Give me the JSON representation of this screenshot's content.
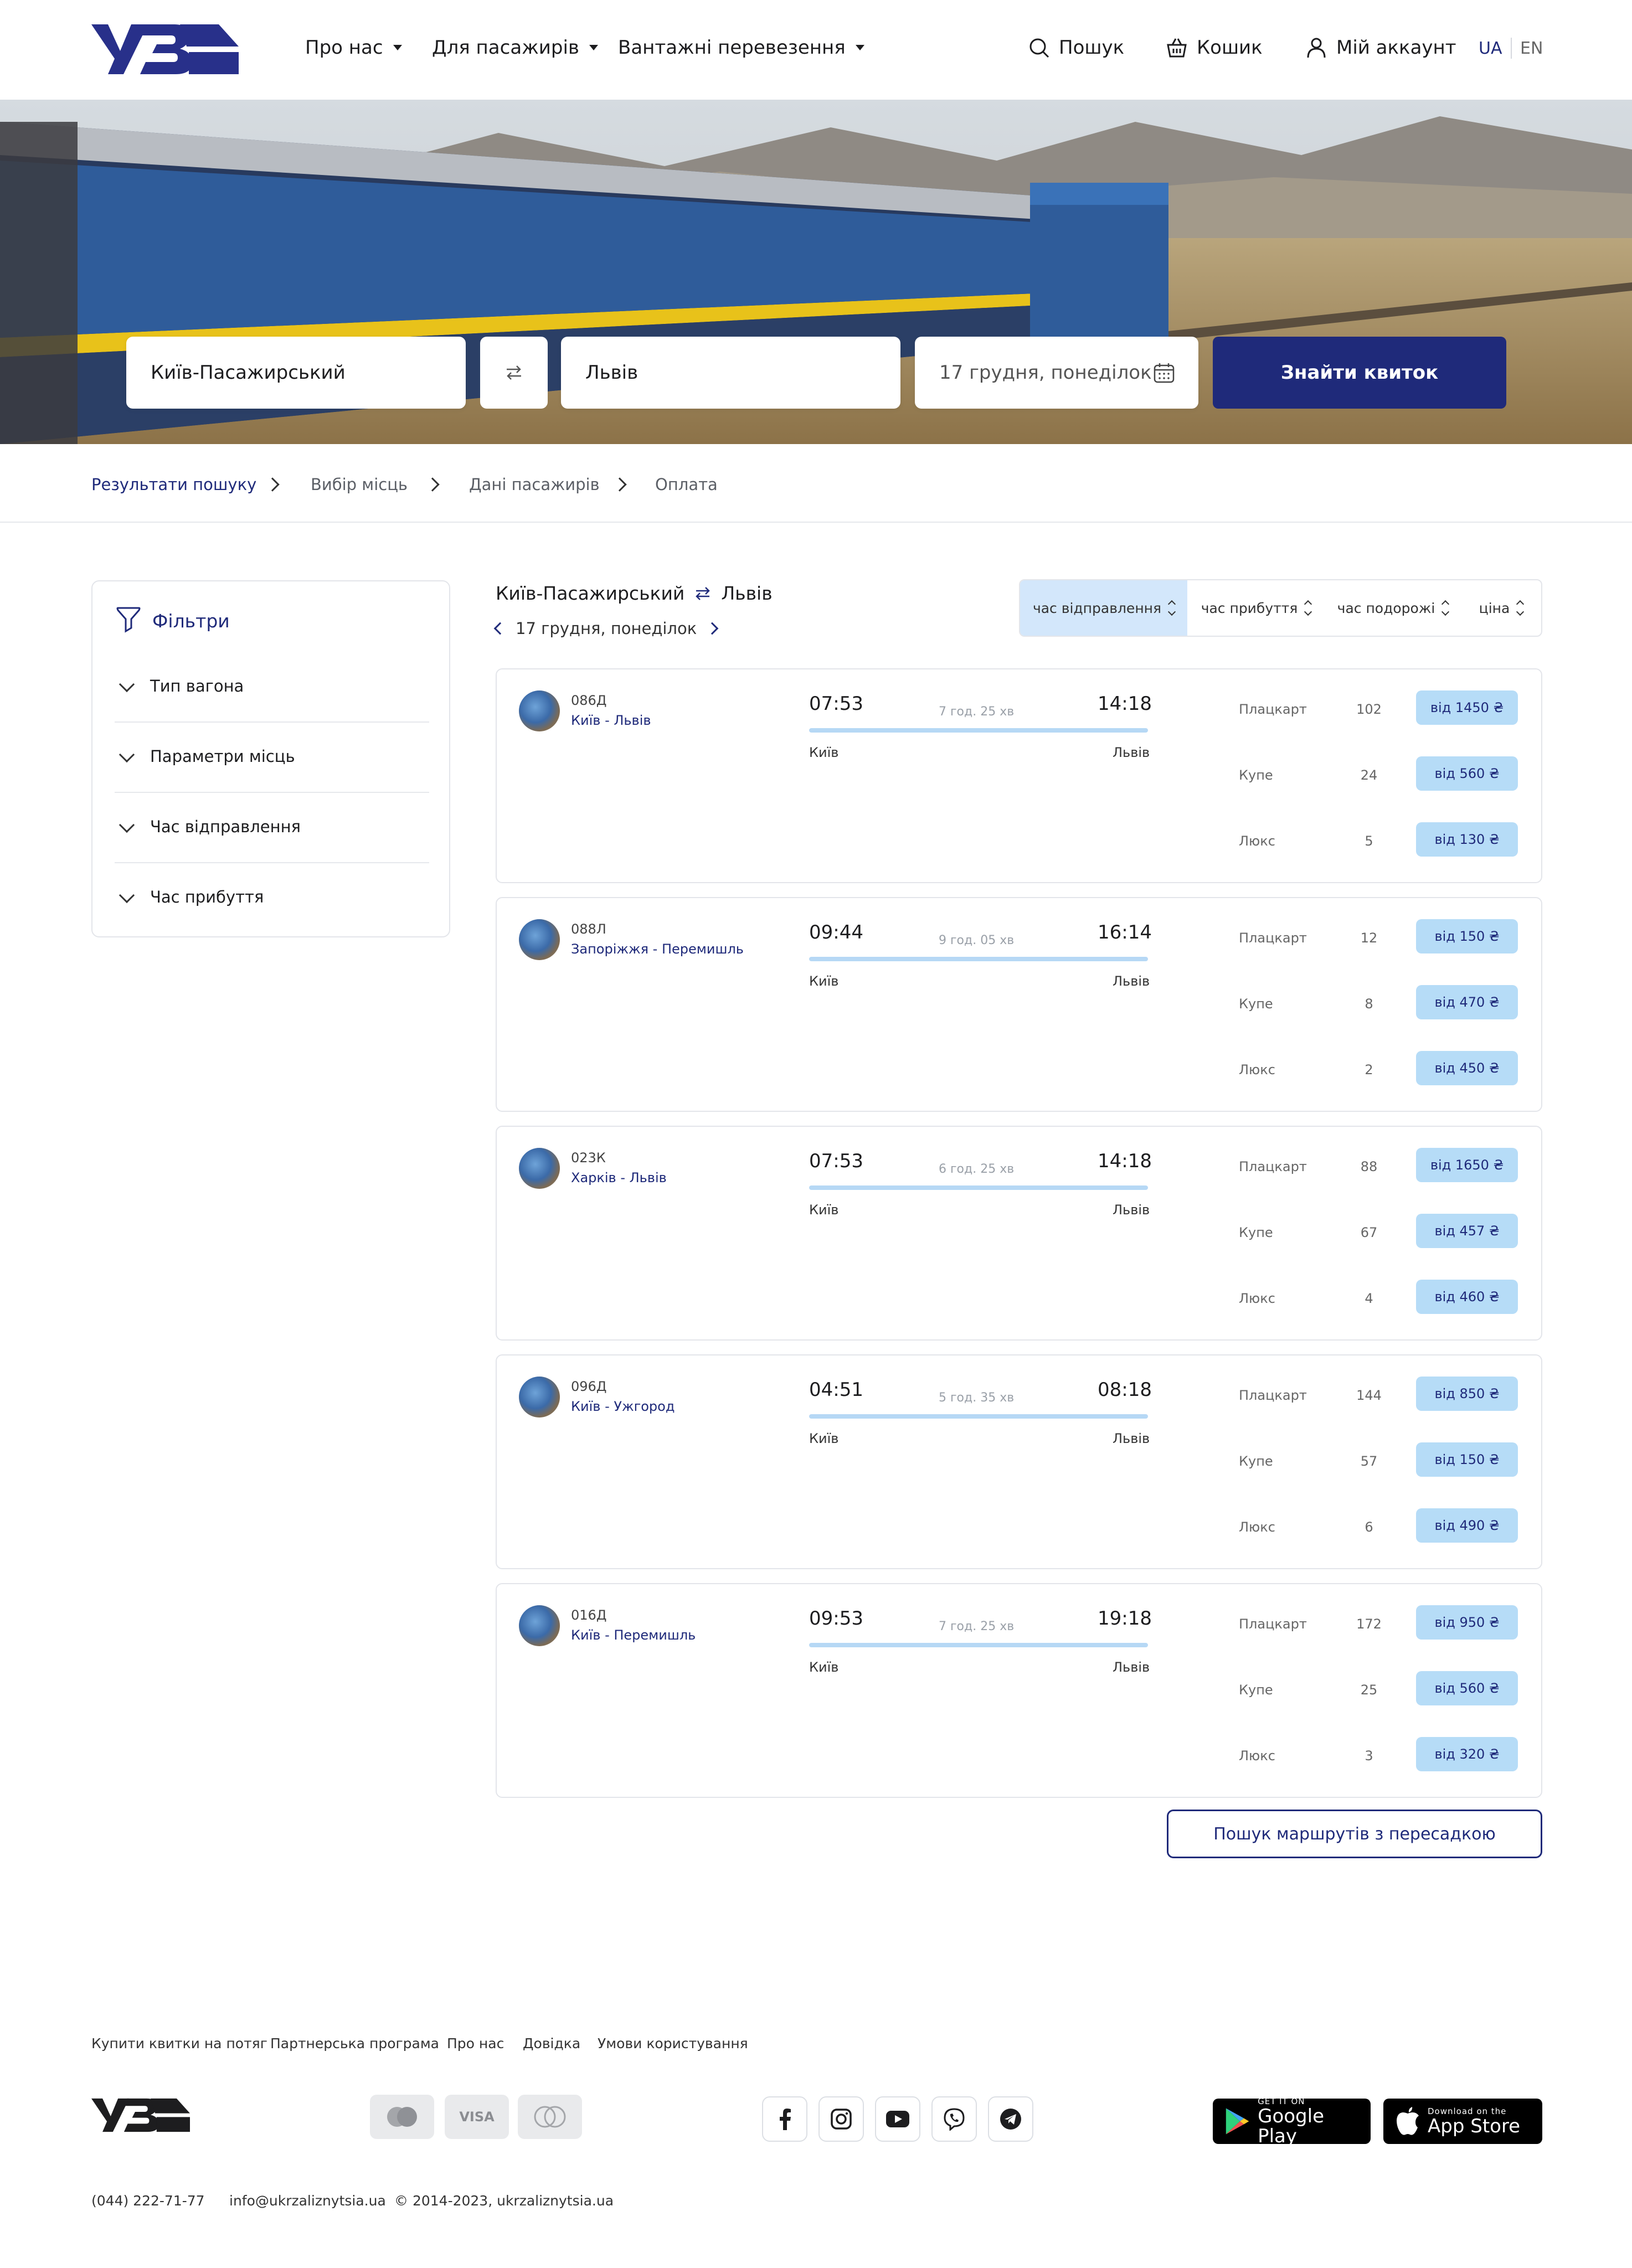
{
  "header": {
    "logo_text": "УЗ",
    "nav": [
      {
        "label": "Про нас"
      },
      {
        "label": "Для пасажирів"
      },
      {
        "label": "Вантажні перевезення"
      }
    ],
    "search_label": "Пошук",
    "cart_label": "Кошик",
    "account_label": "Мій аккаунт",
    "lang_active": "UA",
    "lang_other": "EN"
  },
  "search": {
    "from": "Київ-Пасажирський",
    "to": "Львів",
    "date": "17 грудня, понеділок",
    "button_label": "Знайти квиток"
  },
  "breadcrumbs": [
    {
      "label": "Результати пошуку",
      "active": true
    },
    {
      "label": "Вибір місць",
      "active": false
    },
    {
      "label": "Дані пасажирів",
      "active": false
    },
    {
      "label": "Оплата",
      "active": false
    }
  ],
  "filters": {
    "title": "Фільтри",
    "items": [
      "Тип вагона",
      "Параметри місць",
      "Час відправлення",
      "Час прибуття"
    ]
  },
  "results": {
    "from": "Київ-Пасажирський",
    "to": "Львів",
    "date": "17 грудня, понеділок",
    "sort": [
      {
        "label": "час відправлення",
        "active": true
      },
      {
        "label": "час прибуття",
        "active": false
      },
      {
        "label": "час подорожі",
        "active": false
      },
      {
        "label": "ціна",
        "active": false
      }
    ],
    "trains": [
      {
        "number": "086Д",
        "route": "Київ - Львів",
        "depart": "07:53",
        "arrive": "14:18",
        "duration": "7 год. 25 хв",
        "from_station": "Київ",
        "to_station": "Львів",
        "classes": [
          {
            "name": "Плацкарт",
            "seats": "102",
            "price": "від 1450 ₴"
          },
          {
            "name": "Купе",
            "seats": "24",
            "price": "від 560 ₴"
          },
          {
            "name": "Люкс",
            "seats": "5",
            "price": "від 130 ₴"
          }
        ]
      },
      {
        "number": "088Л",
        "route": "Запоріжжя - Перемишль",
        "depart": "09:44",
        "arrive": "16:14",
        "duration": "9 год. 05 хв",
        "from_station": "Київ",
        "to_station": "Львів",
        "classes": [
          {
            "name": "Плацкарт",
            "seats": "12",
            "price": "від 150 ₴"
          },
          {
            "name": "Купе",
            "seats": "8",
            "price": "від 470 ₴"
          },
          {
            "name": "Люкс",
            "seats": "2",
            "price": "від 450 ₴"
          }
        ]
      },
      {
        "number": "023К",
        "route": "Харків - Львів",
        "depart": "07:53",
        "arrive": "14:18",
        "duration": "6 год. 25 хв",
        "from_station": "Київ",
        "to_station": "Львів",
        "classes": [
          {
            "name": "Плацкарт",
            "seats": "88",
            "price": "від 1650 ₴"
          },
          {
            "name": "Купе",
            "seats": "67",
            "price": "від 457 ₴"
          },
          {
            "name": "Люкс",
            "seats": "4",
            "price": "від 460 ₴"
          }
        ]
      },
      {
        "number": "096Д",
        "route": "Київ - Ужгород",
        "depart": "04:51",
        "arrive": "08:18",
        "duration": "5 год. 35 хв",
        "from_station": "Київ",
        "to_station": "Львів",
        "classes": [
          {
            "name": "Плацкарт",
            "seats": "144",
            "price": "від 850 ₴"
          },
          {
            "name": "Купе",
            "seats": "57",
            "price": "від 150 ₴"
          },
          {
            "name": "Люкс",
            "seats": "6",
            "price": "від 490 ₴"
          }
        ]
      },
      {
        "number": "016Д",
        "route": "Київ - Перемишль",
        "depart": "09:53",
        "arrive": "19:18",
        "duration": "7 год. 25 хв",
        "from_station": "Київ",
        "to_station": "Львів",
        "classes": [
          {
            "name": "Плацкарт",
            "seats": "172",
            "price": "від 950 ₴"
          },
          {
            "name": "Купе",
            "seats": "25",
            "price": "від 560 ₴"
          },
          {
            "name": "Люкс",
            "seats": "3",
            "price": "від 320 ₴"
          }
        ]
      }
    ],
    "transfer_button": "Пошук маршрутів з пересадкою"
  },
  "footer": {
    "links": [
      "Купити квитки на потяг",
      "Партнерська програма",
      "Про нас",
      "Довідка",
      "Умови користування"
    ],
    "logo_text": "УЗ",
    "payments": [
      "mastercard-icon",
      "VISA",
      "maestro-icon"
    ],
    "socials": [
      "facebook-icon",
      "instagram-icon",
      "youtube-icon",
      "viber-icon",
      "telegram-icon"
    ],
    "google_play": {
      "small": "GET IT ON",
      "big": "Google Play"
    },
    "app_store": {
      "small": "Download on the",
      "big": "App Store"
    },
    "phone": "(044) 222-71-77",
    "email": "info@ukrzaliznytsia.ua",
    "copyright": "© 2014-2023, ukrzaliznytsia.ua"
  },
  "colors": {
    "brand": "#1f2a7a",
    "price_bg": "#b6dcf7",
    "sort_active_bg": "#d3e7fb"
  }
}
